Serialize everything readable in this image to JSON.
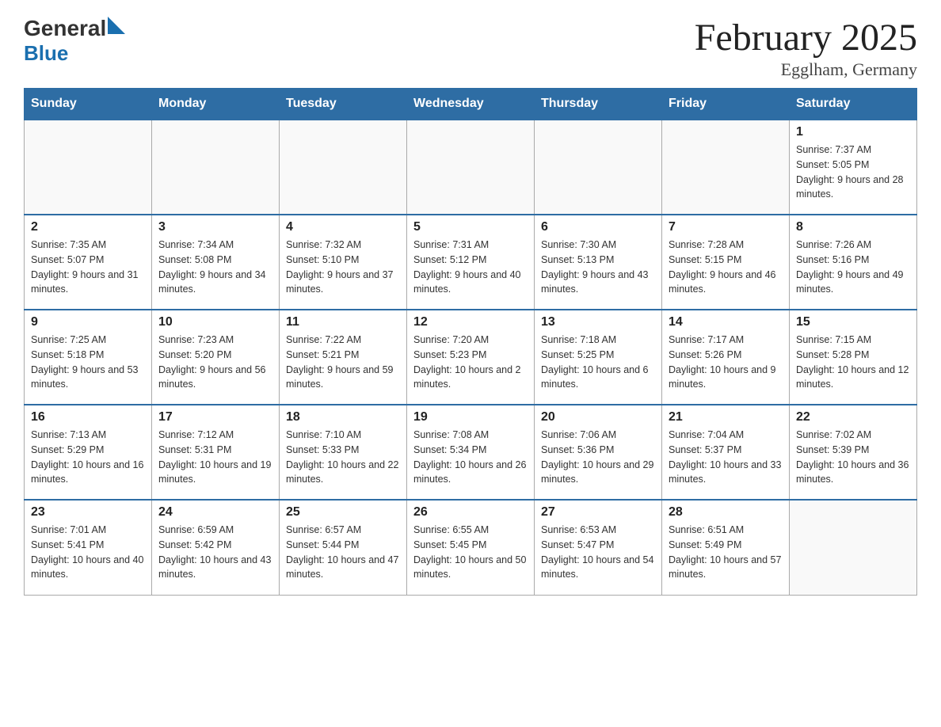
{
  "header": {
    "logo_general": "General",
    "logo_blue": "Blue",
    "month_title": "February 2025",
    "location": "Egglham, Germany"
  },
  "weekdays": [
    "Sunday",
    "Monday",
    "Tuesday",
    "Wednesday",
    "Thursday",
    "Friday",
    "Saturday"
  ],
  "weeks": [
    [
      {
        "day": "",
        "info": ""
      },
      {
        "day": "",
        "info": ""
      },
      {
        "day": "",
        "info": ""
      },
      {
        "day": "",
        "info": ""
      },
      {
        "day": "",
        "info": ""
      },
      {
        "day": "",
        "info": ""
      },
      {
        "day": "1",
        "info": "Sunrise: 7:37 AM\nSunset: 5:05 PM\nDaylight: 9 hours and 28 minutes."
      }
    ],
    [
      {
        "day": "2",
        "info": "Sunrise: 7:35 AM\nSunset: 5:07 PM\nDaylight: 9 hours and 31 minutes."
      },
      {
        "day": "3",
        "info": "Sunrise: 7:34 AM\nSunset: 5:08 PM\nDaylight: 9 hours and 34 minutes."
      },
      {
        "day": "4",
        "info": "Sunrise: 7:32 AM\nSunset: 5:10 PM\nDaylight: 9 hours and 37 minutes."
      },
      {
        "day": "5",
        "info": "Sunrise: 7:31 AM\nSunset: 5:12 PM\nDaylight: 9 hours and 40 minutes."
      },
      {
        "day": "6",
        "info": "Sunrise: 7:30 AM\nSunset: 5:13 PM\nDaylight: 9 hours and 43 minutes."
      },
      {
        "day": "7",
        "info": "Sunrise: 7:28 AM\nSunset: 5:15 PM\nDaylight: 9 hours and 46 minutes."
      },
      {
        "day": "8",
        "info": "Sunrise: 7:26 AM\nSunset: 5:16 PM\nDaylight: 9 hours and 49 minutes."
      }
    ],
    [
      {
        "day": "9",
        "info": "Sunrise: 7:25 AM\nSunset: 5:18 PM\nDaylight: 9 hours and 53 minutes."
      },
      {
        "day": "10",
        "info": "Sunrise: 7:23 AM\nSunset: 5:20 PM\nDaylight: 9 hours and 56 minutes."
      },
      {
        "day": "11",
        "info": "Sunrise: 7:22 AM\nSunset: 5:21 PM\nDaylight: 9 hours and 59 minutes."
      },
      {
        "day": "12",
        "info": "Sunrise: 7:20 AM\nSunset: 5:23 PM\nDaylight: 10 hours and 2 minutes."
      },
      {
        "day": "13",
        "info": "Sunrise: 7:18 AM\nSunset: 5:25 PM\nDaylight: 10 hours and 6 minutes."
      },
      {
        "day": "14",
        "info": "Sunrise: 7:17 AM\nSunset: 5:26 PM\nDaylight: 10 hours and 9 minutes."
      },
      {
        "day": "15",
        "info": "Sunrise: 7:15 AM\nSunset: 5:28 PM\nDaylight: 10 hours and 12 minutes."
      }
    ],
    [
      {
        "day": "16",
        "info": "Sunrise: 7:13 AM\nSunset: 5:29 PM\nDaylight: 10 hours and 16 minutes."
      },
      {
        "day": "17",
        "info": "Sunrise: 7:12 AM\nSunset: 5:31 PM\nDaylight: 10 hours and 19 minutes."
      },
      {
        "day": "18",
        "info": "Sunrise: 7:10 AM\nSunset: 5:33 PM\nDaylight: 10 hours and 22 minutes."
      },
      {
        "day": "19",
        "info": "Sunrise: 7:08 AM\nSunset: 5:34 PM\nDaylight: 10 hours and 26 minutes."
      },
      {
        "day": "20",
        "info": "Sunrise: 7:06 AM\nSunset: 5:36 PM\nDaylight: 10 hours and 29 minutes."
      },
      {
        "day": "21",
        "info": "Sunrise: 7:04 AM\nSunset: 5:37 PM\nDaylight: 10 hours and 33 minutes."
      },
      {
        "day": "22",
        "info": "Sunrise: 7:02 AM\nSunset: 5:39 PM\nDaylight: 10 hours and 36 minutes."
      }
    ],
    [
      {
        "day": "23",
        "info": "Sunrise: 7:01 AM\nSunset: 5:41 PM\nDaylight: 10 hours and 40 minutes."
      },
      {
        "day": "24",
        "info": "Sunrise: 6:59 AM\nSunset: 5:42 PM\nDaylight: 10 hours and 43 minutes."
      },
      {
        "day": "25",
        "info": "Sunrise: 6:57 AM\nSunset: 5:44 PM\nDaylight: 10 hours and 47 minutes."
      },
      {
        "day": "26",
        "info": "Sunrise: 6:55 AM\nSunset: 5:45 PM\nDaylight: 10 hours and 50 minutes."
      },
      {
        "day": "27",
        "info": "Sunrise: 6:53 AM\nSunset: 5:47 PM\nDaylight: 10 hours and 54 minutes."
      },
      {
        "day": "28",
        "info": "Sunrise: 6:51 AM\nSunset: 5:49 PM\nDaylight: 10 hours and 57 minutes."
      },
      {
        "day": "",
        "info": ""
      }
    ]
  ]
}
